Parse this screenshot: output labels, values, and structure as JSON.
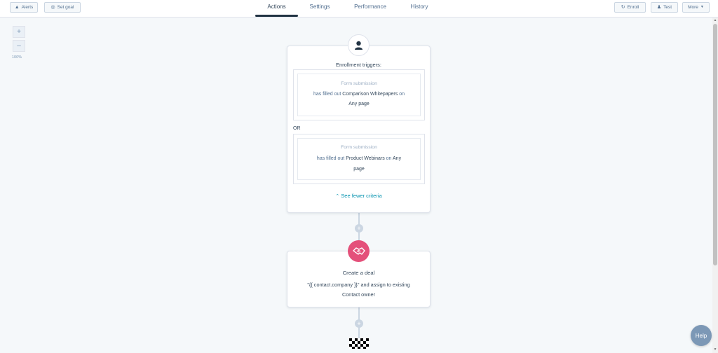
{
  "toolbar_left": {
    "alerts_label": "Alerts",
    "set_goal_label": "Set goal"
  },
  "tabs": [
    {
      "label": "Actions",
      "active": true
    },
    {
      "label": "Settings",
      "active": false
    },
    {
      "label": "Performance",
      "active": false
    },
    {
      "label": "History",
      "active": false
    }
  ],
  "toolbar_right": {
    "enroll_label": "Enroll",
    "test_label": "Test",
    "more_label": "More"
  },
  "zoom": {
    "plus": "+",
    "minus": "–",
    "level": "100%"
  },
  "trigger_card": {
    "title": "Enrollment triggers:",
    "triggers": [
      {
        "type": "Form submission",
        "prefix": "has filled out",
        "form_name": "Comparison Whitepapers",
        "on": "on",
        "page": "Any page"
      },
      {
        "type": "Form submission",
        "prefix": "has filled out",
        "form_name": "Product Webinars",
        "on": "on",
        "page_part1": "Any",
        "page_part2": "page"
      }
    ],
    "or_label": "OR",
    "see_fewer": "See fewer criteria"
  },
  "action_card": {
    "title": "Create a deal",
    "line1": "\"{{ contact.company }}\" and assign to existing",
    "line2": "Contact owner",
    "icon_color": "#e4507a"
  },
  "plus_node_label": "+",
  "help_label": "Help",
  "colors": {
    "accent": "#0091ae",
    "tab_underline": "#213343",
    "deal_icon": "#e4507a",
    "help_button": "#7c98b6"
  },
  "icons": {
    "alerts": "warning-triangle-icon",
    "set_goal": "target-icon",
    "enroll": "refresh-icon",
    "test": "person-icon",
    "more": "caret-down-icon",
    "trigger": "contact-avatar-icon",
    "deal": "handshake-icon",
    "end": "checkered-flag-icon"
  }
}
